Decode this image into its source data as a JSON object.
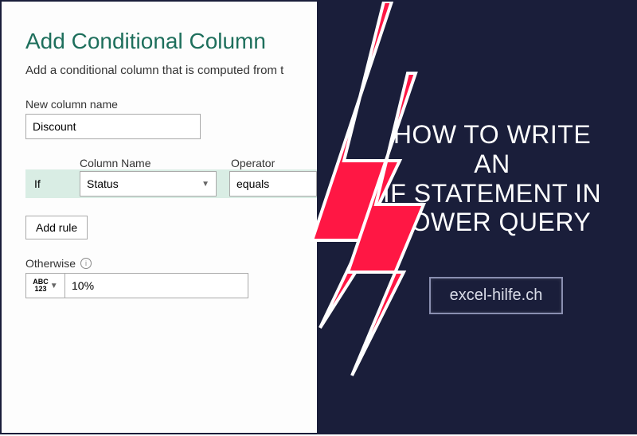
{
  "dialog": {
    "title": "Add Conditional Column",
    "description": "Add a conditional column that is computed from t",
    "new_col_label": "New column name",
    "new_col_value": "Discount",
    "headers": {
      "column_name": "Column Name",
      "operator": "Operator"
    },
    "if_label": "If",
    "selected_column": "Status",
    "selected_operator": "equals",
    "add_rule_label": "Add rule",
    "otherwise_label": "Otherwise",
    "otherwise_value": "10%",
    "type_picker_top": "ABC",
    "type_picker_bottom": "123"
  },
  "promo": {
    "headline_l1": "HOW TO WRITE AN",
    "headline_l2": "IF STATEMENT IN",
    "headline_l3": "POWER QUERY",
    "site": "excel-hilfe.ch"
  }
}
